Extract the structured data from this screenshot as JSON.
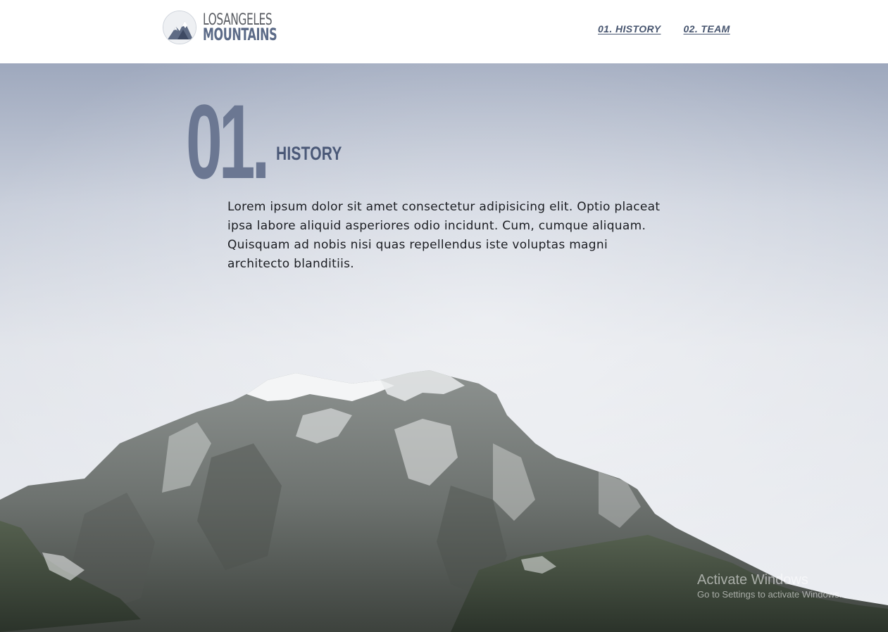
{
  "header": {
    "logo": {
      "line1": "LOSANGELES",
      "line2": "MOUNTAINS",
      "icon": "mountain-logo-icon"
    },
    "nav": [
      {
        "label": "01. HISTORY"
      },
      {
        "label": "02. TEAM"
      }
    ]
  },
  "hero": {
    "section_number": "01.",
    "section_title": "HISTORY",
    "body": "Lorem ipsum dolor sit amet consectetur adipisicing elit. Optio placeat ipsa labore aliquid asperiores odio incidunt. Cum, cumque aliquam. Quisquam ad nobis nisi quas repellendus iste voluptas magni architecto blanditiis.",
    "background": "snowy-mountain-photo"
  },
  "watermark": {
    "title": "Activate Windows",
    "subtitle": "Go to Settings to activate Windows."
  },
  "colors": {
    "accent": "#47556f",
    "number": "#6b7792",
    "text": "#1b1d22"
  }
}
